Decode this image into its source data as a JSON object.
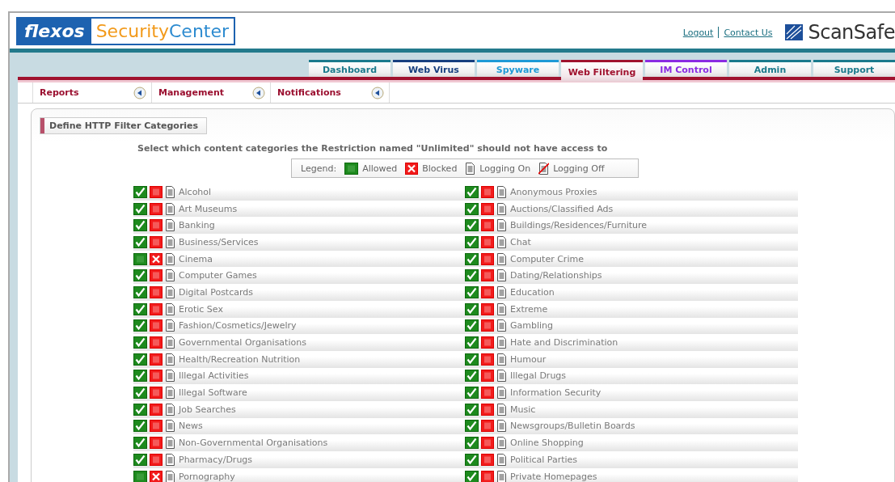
{
  "logo": {
    "brand": "flexos",
    "product_words": [
      "Security",
      "Center"
    ]
  },
  "header_links": [
    "Logout",
    "Contact Us"
  ],
  "partner_logo": {
    "name": "ScanSafe"
  },
  "tabs": [
    {
      "label": "Dashboard",
      "selected": false,
      "color": "#1b7a8c"
    },
    {
      "label": "Web Virus",
      "selected": false,
      "color": "#173f7f"
    },
    {
      "label": "Spyware",
      "selected": false,
      "color": "#1e9ad6"
    },
    {
      "label": "Web Filtering",
      "selected": true,
      "color": "#a0122e"
    },
    {
      "label": "IM Control",
      "selected": false,
      "color": "#8a2be2"
    },
    {
      "label": "Admin",
      "selected": false,
      "color": "#1b7a8c"
    },
    {
      "label": "Support",
      "selected": false,
      "color": "#1b7a8c"
    }
  ],
  "subnav": [
    {
      "label": "Reports"
    },
    {
      "label": "Management"
    },
    {
      "label": "Notifications"
    }
  ],
  "panel_title": "Define HTTP Filter Categories",
  "instruction": "Select which content categories the Restriction named \"Unlimited\" should not have access to",
  "legend": {
    "label": "Legend:",
    "allowed": "Allowed",
    "blocked": "Blocked",
    "logging_on": "Logging On",
    "logging_off": "Logging Off"
  },
  "category_columns": [
    [
      {
        "name": "Alcohol",
        "blocked": false
      },
      {
        "name": "Art Museums",
        "blocked": false
      },
      {
        "name": "Banking",
        "blocked": false
      },
      {
        "name": "Business/Services",
        "blocked": false
      },
      {
        "name": "Cinema",
        "blocked": true
      },
      {
        "name": "Computer Games",
        "blocked": false
      },
      {
        "name": "Digital Postcards",
        "blocked": false
      },
      {
        "name": "Erotic Sex",
        "blocked": false
      },
      {
        "name": "Fashion/Cosmetics/Jewelry",
        "blocked": false
      },
      {
        "name": "Governmental Organisations",
        "blocked": false
      },
      {
        "name": "Health/Recreation Nutrition",
        "blocked": false
      },
      {
        "name": "Illegal Activities",
        "blocked": false
      },
      {
        "name": "Illegal Software",
        "blocked": false
      },
      {
        "name": "Job Searches",
        "blocked": false
      },
      {
        "name": "News",
        "blocked": false
      },
      {
        "name": "Non-Governmental Organisations",
        "blocked": false
      },
      {
        "name": "Pharmacy/Drugs",
        "blocked": false
      },
      {
        "name": "Pornography",
        "blocked": true
      }
    ],
    [
      {
        "name": "Anonymous Proxies",
        "blocked": false
      },
      {
        "name": "Auctions/Classified Ads",
        "blocked": false
      },
      {
        "name": "Buildings/Residences/Furniture",
        "blocked": false
      },
      {
        "name": "Chat",
        "blocked": false
      },
      {
        "name": "Computer Crime",
        "blocked": false
      },
      {
        "name": "Dating/Relationships",
        "blocked": false
      },
      {
        "name": "Education",
        "blocked": false
      },
      {
        "name": "Extreme",
        "blocked": false
      },
      {
        "name": "Gambling",
        "blocked": false
      },
      {
        "name": "Hate and Discrimination",
        "blocked": false
      },
      {
        "name": "Humour",
        "blocked": false
      },
      {
        "name": "Illegal Drugs",
        "blocked": false
      },
      {
        "name": "Information Security",
        "blocked": false
      },
      {
        "name": "Music",
        "blocked": false
      },
      {
        "name": "Newsgroups/Bulletin Boards",
        "blocked": false
      },
      {
        "name": "Online Shopping",
        "blocked": false
      },
      {
        "name": "Political Parties",
        "blocked": false
      },
      {
        "name": "Private Homepages",
        "blocked": false
      }
    ]
  ]
}
